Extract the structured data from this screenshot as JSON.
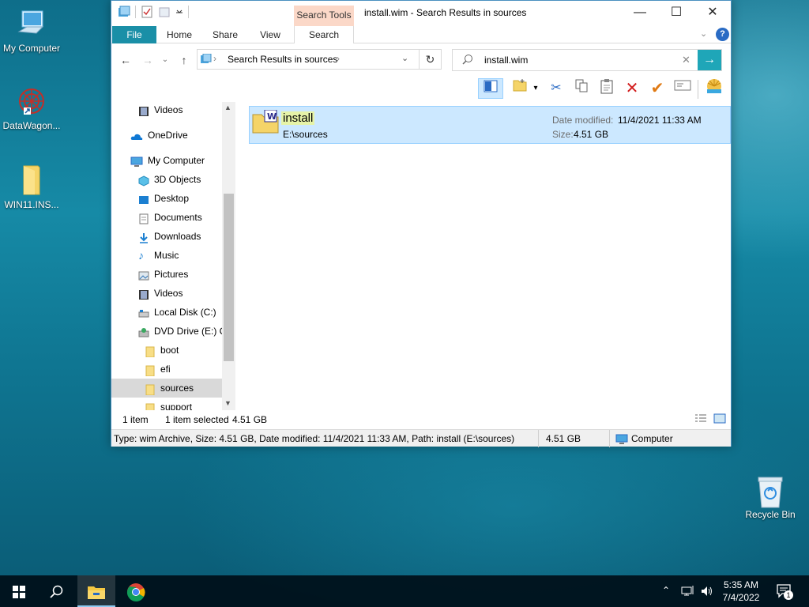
{
  "desktop": {
    "icons": [
      {
        "label": "My Computer",
        "icon": "computer-icon"
      },
      {
        "label": "DataWagon...",
        "icon": "app-shortcut-icon"
      },
      {
        "label": "WIN11.INS...",
        "icon": "folder-icon"
      },
      {
        "label": "Recycle Bin",
        "icon": "recycle-bin-icon"
      }
    ]
  },
  "window": {
    "title": "install.wim - Search Results in sources",
    "contextual_tab_group": "Search Tools",
    "tabs": [
      "File",
      "Home",
      "Share",
      "View",
      "Search"
    ],
    "address": {
      "path": "Search Results in sources",
      "chevron": "›"
    },
    "search": {
      "value": "install.wim"
    },
    "nav": {
      "items": [
        {
          "label": "Videos",
          "icon": "videos-icon"
        },
        {
          "label": "OneDrive",
          "icon": "onedrive-icon"
        },
        {
          "label": "My Computer",
          "icon": "computer-icon"
        },
        {
          "label": "3D Objects",
          "icon": "3d-objects-icon"
        },
        {
          "label": "Desktop",
          "icon": "desktop-icon"
        },
        {
          "label": "Documents",
          "icon": "documents-icon"
        },
        {
          "label": "Downloads",
          "icon": "downloads-icon"
        },
        {
          "label": "Music",
          "icon": "music-icon"
        },
        {
          "label": "Pictures",
          "icon": "pictures-icon"
        },
        {
          "label": "Videos",
          "icon": "videos-icon"
        },
        {
          "label": "Local Disk (C:)",
          "icon": "drive-icon"
        },
        {
          "label": "DVD Drive (E:) C(",
          "icon": "dvd-drive-icon"
        },
        {
          "label": "boot",
          "icon": "folder-icon"
        },
        {
          "label": "efi",
          "icon": "folder-icon"
        },
        {
          "label": "sources",
          "icon": "folder-icon"
        },
        {
          "label": "support",
          "icon": "folder-icon"
        }
      ],
      "selected": "sources"
    },
    "result": {
      "name": "install",
      "location": "E:\\sources",
      "date_label": "Date modified:",
      "date_value": "11/4/2021 11:33 AM",
      "size_label": "Size:",
      "size_value": "4.51 GB"
    },
    "status": {
      "count": "1 item",
      "selection": "1 item selected",
      "selection_size": "4.51 GB"
    },
    "details": {
      "text": "Type: wim Archive, Size: 4.51 GB, Date modified: 11/4/2021 11:33 AM, Path: install (E:\\sources)",
      "size": "4.51 GB",
      "location": "Computer"
    }
  },
  "taskbar": {
    "time": "5:35 AM",
    "date": "7/4/2022",
    "notification_count": "1"
  },
  "colors": {
    "file_tab": "#1a8fa7",
    "selection": "#cce8ff",
    "search_go": "#1fa6b8",
    "context_tab": "#fbd8c8"
  }
}
